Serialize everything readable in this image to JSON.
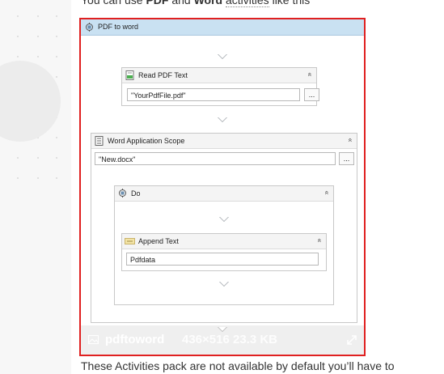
{
  "intro": {
    "prefix": "You can use ",
    "bold1": "PDF",
    "middle": " and ",
    "bold2": "Word",
    "space": " ",
    "link": "activities",
    "suffix": " like this"
  },
  "workflow": {
    "sequence_title": "PDF to word",
    "read_pdf": {
      "title": "Read PDF Text",
      "value": "\"YourPdfFile.pdf\"",
      "button": "..."
    },
    "word_scope": {
      "title": "Word Application Scope",
      "value": "\"New.docx\"",
      "button": "..."
    },
    "do_block": {
      "title": "Do"
    },
    "append_text": {
      "title": "Append Text",
      "value": "Pdfdata"
    },
    "collapse_symbol": "«"
  },
  "image_overlay": {
    "name": "pdftoword",
    "meta": "436×516 23.3 KB"
  },
  "footer": {
    "text": "These Activities pack are not available by default you’ll have to"
  },
  "colors": {
    "highlight_border": "#e02020",
    "sequence_header": "#c9e1f2"
  }
}
